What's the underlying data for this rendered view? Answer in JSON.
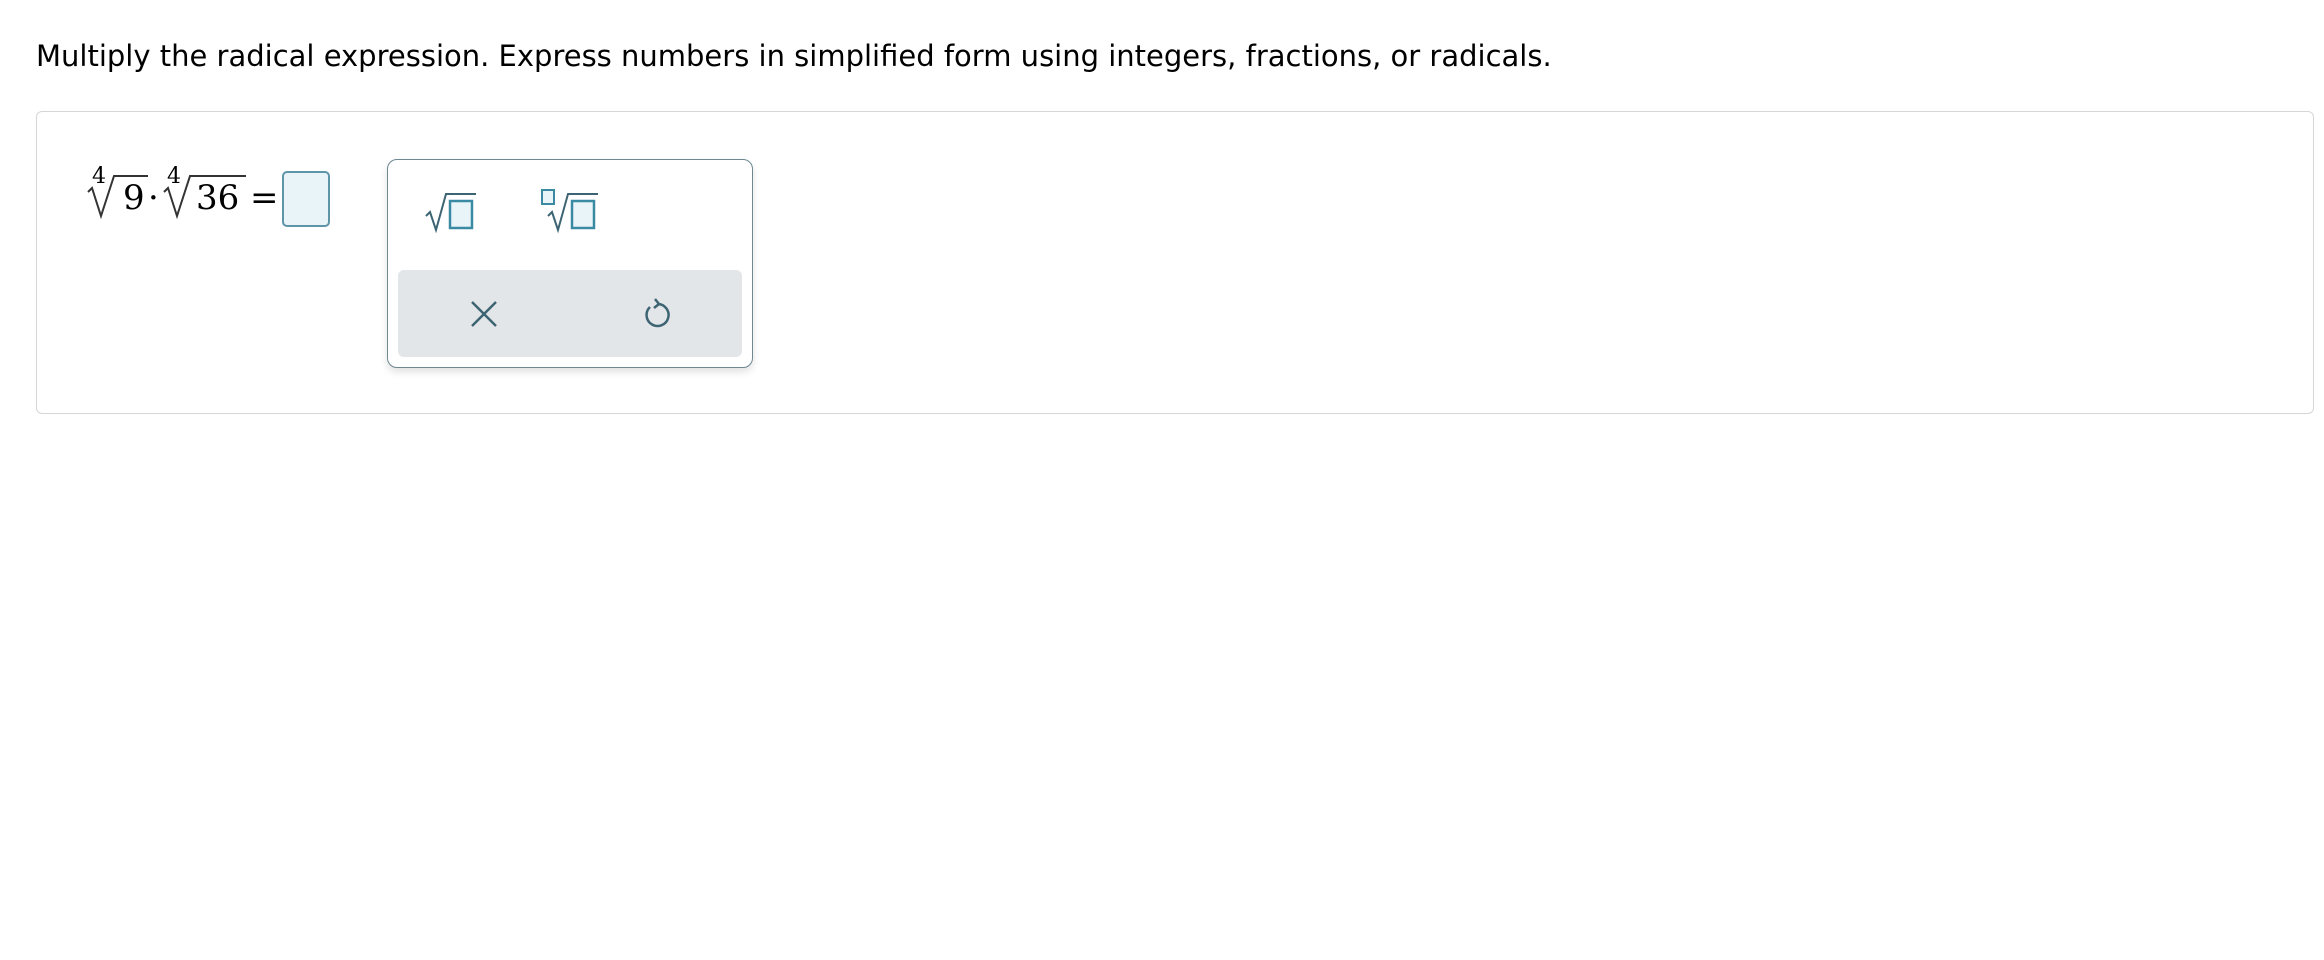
{
  "instructions": "Multiply the radical expression. Express numbers in simplified form using integers, fractions, or radicals.",
  "expression": {
    "term1": {
      "index": "4",
      "radicand": "9"
    },
    "operator": "·",
    "term2": {
      "index": "4",
      "radicand": "36"
    },
    "equals": "="
  },
  "answer": {
    "value": ""
  },
  "palette": {
    "tools": [
      {
        "icon": "square-root-icon"
      },
      {
        "icon": "nth-root-icon"
      }
    ],
    "actions": [
      {
        "icon": "clear-icon"
      },
      {
        "icon": "undo-icon"
      }
    ]
  },
  "colors": {
    "accent": "#3b8aa3",
    "answer_fill": "#e8f4f8",
    "icon_stroke": "#3d6473",
    "action_bar_bg": "#e2e6e8",
    "panel_border": "#d6d6d6"
  }
}
